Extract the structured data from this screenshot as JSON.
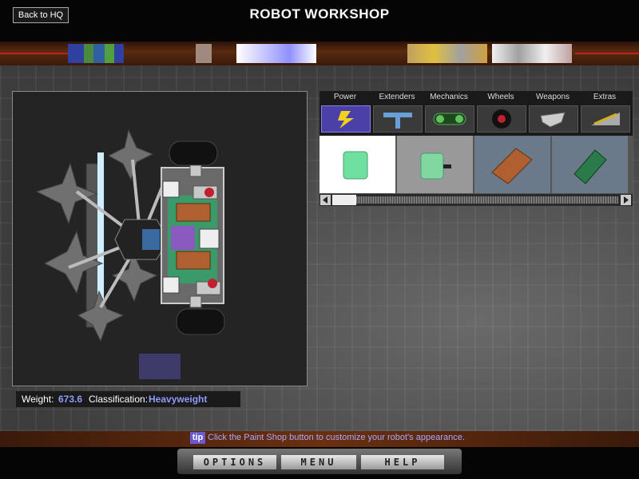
{
  "header": {
    "back_label": "Back to HQ",
    "title": "ROBOT WORKSHOP"
  },
  "tabs": [
    {
      "label": "Power",
      "icon": "lightning-bolt-icon",
      "active": true
    },
    {
      "label": "Extenders",
      "icon": "t-extender-icon",
      "active": false
    },
    {
      "label": "Mechanics",
      "icon": "belt-pulley-icon",
      "active": false
    },
    {
      "label": "Wheels",
      "icon": "wheel-icon",
      "active": false
    },
    {
      "label": "Weapons",
      "icon": "blade-icon",
      "active": false
    },
    {
      "label": "Extras",
      "icon": "wedge-icon",
      "active": false
    }
  ],
  "parts": [
    {
      "name": "green-battery-icon",
      "selected": true
    },
    {
      "name": "green-battery-with-plug-icon",
      "selected": false
    },
    {
      "name": "orange-circuit-board-icon",
      "selected": false
    },
    {
      "name": "green-circuit-board-icon",
      "selected": false
    }
  ],
  "stats": {
    "weight_label": "Weight:",
    "weight_value": "673.6",
    "class_label": "Classification:",
    "class_value": "Heavyweight"
  },
  "tip": {
    "badge": "tip",
    "text": "Click the Paint Shop button to customize your robot's appearance."
  },
  "nav": {
    "options": "OPTIONS",
    "menu": "MENU",
    "help": "HELP"
  },
  "colors": {
    "accent": "#4a40a8",
    "value_text": "#8f9cff",
    "tip_text": "#a8a8ff"
  }
}
